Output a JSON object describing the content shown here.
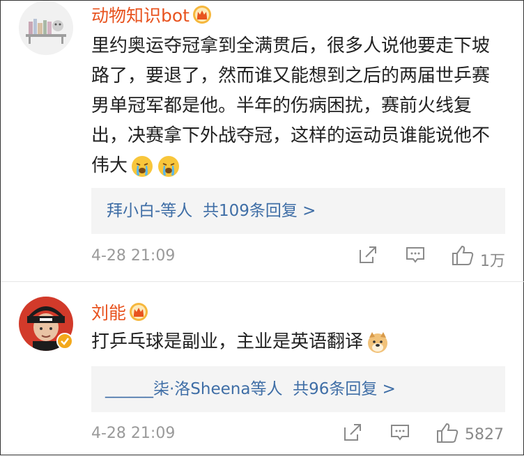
{
  "comments": [
    {
      "username": "动物知识bot",
      "text": "里约奥运夺冠拿到全满贯后，很多人说他要走下坡路了，要退了，然而谁又能想到之后的两届世乒赛男单冠军都是他。半年的伤病困扰，赛前火线复出，决赛拿下外战夺冠，这样的运动员谁能说他不伟大",
      "emojis": [
        "crying-face",
        "crying-face"
      ],
      "replies_names": "拜小白-等人",
      "replies_count": "共109条回复 >",
      "time": "4-28 21:09",
      "likes": "1万"
    },
    {
      "username": "刘能",
      "text": "打乒乓球是副业，主业是英语翻译",
      "emojis": [
        "doge"
      ],
      "replies_prefix": "______",
      "replies_names": "柒·洛Sheena等人",
      "replies_count": "共96条回复 >",
      "time": "4-28 21:09",
      "likes": "5827"
    }
  ],
  "colors": {
    "username": "#e8531f",
    "link": "#3f6ea6",
    "meta": "#9a9a9a",
    "reply_bg": "#f4f4f4"
  },
  "icons": [
    "crown-badge-icon",
    "share-icon",
    "comment-icon",
    "like-icon",
    "verified-badge-icon"
  ]
}
